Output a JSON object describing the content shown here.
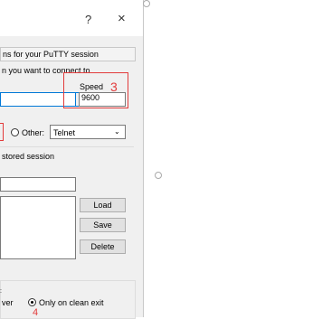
{
  "titlebar": {
    "help": "?",
    "close": "×"
  },
  "header": {
    "text": "ns for your PuTTY session"
  },
  "host": {
    "label": "n you want to connect to",
    "value": ""
  },
  "speed": {
    "label": "Speed",
    "value": "9600"
  },
  "annotations": {
    "three": "3",
    "four": "4"
  },
  "protocol": {
    "other_label": "Other:",
    "selected": "Telnet"
  },
  "sessions": {
    "label": "stored session",
    "name_value": "",
    "load": "Load",
    "save": "Save",
    "delete": "Delete"
  },
  "close_on_exit": {
    "never_fragment": "ver",
    "clean_label": "Only on clean exit"
  },
  "colors": {
    "accent": "#0078d7",
    "annotation": "#e23b3b"
  }
}
